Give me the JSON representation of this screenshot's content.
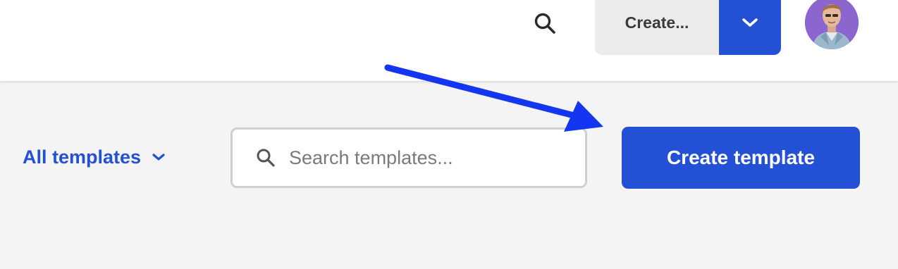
{
  "header": {
    "search_icon": "search-icon",
    "create_button_label": "Create...",
    "create_dropdown_icon": "chevron-down-icon",
    "avatar_alt": "user-avatar"
  },
  "toolbar": {
    "filter_label": "All templates",
    "filter_icon": "chevron-down-icon",
    "search_placeholder": "Search templates...",
    "search_value": "",
    "create_template_label": "Create template"
  },
  "colors": {
    "accent": "#2450d6",
    "annotation_arrow": "#1536f0",
    "background": "#f4f4f4",
    "header_background": "#ffffff",
    "create_button_background": "#ececec"
  }
}
